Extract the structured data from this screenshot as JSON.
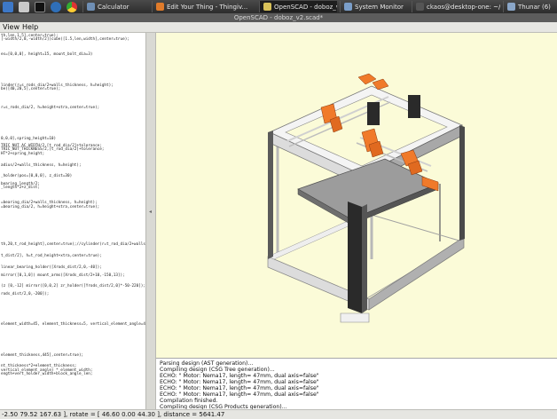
{
  "taskbar": {
    "tasks": [
      {
        "label": "Calculator",
        "color": "#6f8fb5"
      },
      {
        "label": "Edit Your Thing - Thingiv...",
        "color": "#e07b2a"
      },
      {
        "label": "OpenSCAD - doboz_v2...",
        "color": "#d9c25a"
      },
      {
        "label": "System Monitor",
        "color": "#7a9ec9"
      },
      {
        "label": "ckaos@desktop-one: ~/...",
        "color": "#555555"
      },
      {
        "label": "Thunar (6)",
        "color": "#8aa6c8"
      }
    ]
  },
  "window": {
    "title": "OpenSCAD - doboz_v2.scad*"
  },
  "menubar": {
    "items": [
      "View",
      "Help"
    ]
  },
  "editor": {
    "lines": [
      "th,len,1.5],center=true);",
      "[-width/2,0,-width/2])cube([1.5,len,width],center=true);",
      "",
      "",
      "",
      "es=[0,0,0], height=15, mount_bolt_dia=3)",
      "",
      "",
      "",
      "",
      "",
      "",
      "",
      "linder(r=s_rods_dia/2+walls_thickness, h=height);",
      "be([40,20,5],center=true);",
      "",
      "",
      "",
      "",
      "r=s_rods_dia/2, h=height+xtra,center=true);",
      "",
      "",
      "",
      "",
      "",
      "",
      "",
      "0,0,0],spring_height=10)",
      "",
      "TRIC_NUT_AC_WIDTH/2,[t_rod_dia/2]+tolerance;",
      "TRIC_NUT_THICKNESS/2,[t_rod_dia/2]+tolerance;",
      "HT*2+spring_height;",
      "",
      "",
      "adius/2+walls_thickness, h=height);",
      "",
      "",
      "_holder(pos=[0,0,0], z_dist=30)",
      "",
      "bearing_length/2;",
      "_length*2+z_dist;",
      "",
      "",
      "",
      "=bearing_dia/2+walls_thickness, h=height);",
      "=bearing_dia/2, h=height+xtra,center=true);",
      "",
      "",
      "",
      "",
      "",
      "",
      "",
      "",
      "",
      "th,20,t_rod_height],center=true);//cylinder(r=t_rod_dia/2+walls_thickness/",
      "",
      "",
      "t_dist/2], h=t_rod_height+xtra,center=true);",
      "",
      "",
      "    linear_bearing_holder([Xrods_dist/2,0,-40]);",
      "",
      "    mirror([0,1,0]) mount_arms([Xrods_dist/2+10,-150,13]);",
      "",
      "",
      "(z [0,-12] mirror([0,0,2] zr_holder([Yrods_dist/2,0]*-50-220]);",
      "",
      "rods_dist/2,0,-200]);",
      "",
      "",
      "",
      "",
      "",
      "",
      "",
      "element_width=45, element_thickness=5, vertical_element_angle=45, wall_t",
      "",
      "",
      "",
      "",
      "",
      "",
      "",
      "element_thickness,445],center=true);",
      "",
      "",
      "nt_thickness*2+element_thickness;",
      "vertical_element_angle) * element_width;",
      "ength+vert_holder_width+block_angle_len;",
      "",
      "",
      "",
      "",
      "",
      "",
      "",
      "",
      "",
      "wth_block angle len of 1 aca[1] block angle len"
    ]
  },
  "console": {
    "lines": [
      "Parsing design (AST generation)...",
      "Compiling design (CSG Tree generation)...",
      "ECHO: \"  Motor: Nema17, length= 47mm, dual axis=false\"",
      "ECHO: \"  Motor: Nema17, length= 47mm, dual axis=false\"",
      "ECHO: \"  Motor: Nema17, length= 47mm, dual axis=false\"",
      "ECHO: \"  Motor: Nema17, length= 47mm, dual axis=false\"",
      "Compilation finished.",
      "Compiling design (CSG Products generation)..."
    ]
  },
  "statusbar": {
    "text": "-2.50 79.52 167.63 ], rotate = [ 46.60 0.00 44.30 ], distance = 5641.47"
  },
  "colors": {
    "viewport_bg": "#fbfbd8",
    "frame_top": "#f2f2f2",
    "frame_side": "#9a9a9a",
    "part_orange": "#f07a2a",
    "post_dark": "#2a2a2a"
  }
}
